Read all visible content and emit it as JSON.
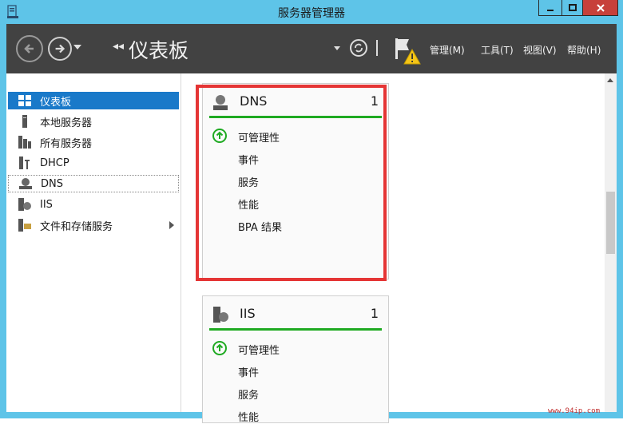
{
  "window": {
    "title": "服务器管理器"
  },
  "toolbar": {
    "breadcrumb": "仪表板",
    "menus": [
      "管理(M)",
      "工具(T)",
      "视图(V)",
      "帮助(H)"
    ]
  },
  "sidebar": {
    "items": [
      {
        "label": "仪表板",
        "icon": "dashboard-icon"
      },
      {
        "label": "本地服务器",
        "icon": "server-icon"
      },
      {
        "label": "所有服务器",
        "icon": "servers-icon"
      },
      {
        "label": "DHCP",
        "icon": "dhcp-icon"
      },
      {
        "label": "DNS",
        "icon": "dns-icon"
      },
      {
        "label": "IIS",
        "icon": "iis-icon"
      },
      {
        "label": "文件和存储服务",
        "icon": "storage-icon"
      }
    ]
  },
  "tiles": [
    {
      "name": "DNS",
      "count": "1",
      "rows": [
        "可管理性",
        "事件",
        "服务",
        "性能",
        "BPA 结果"
      ]
    },
    {
      "name": "IIS",
      "count": "1",
      "rows": [
        "可管理性",
        "事件",
        "服务",
        "性能"
      ]
    }
  ],
  "watermark": "www.94ip.com",
  "colors": {
    "accent": "#1979c9",
    "status_ok": "#1faa22",
    "highlight": "#e53535",
    "titlebar": "#5ec4e8"
  }
}
